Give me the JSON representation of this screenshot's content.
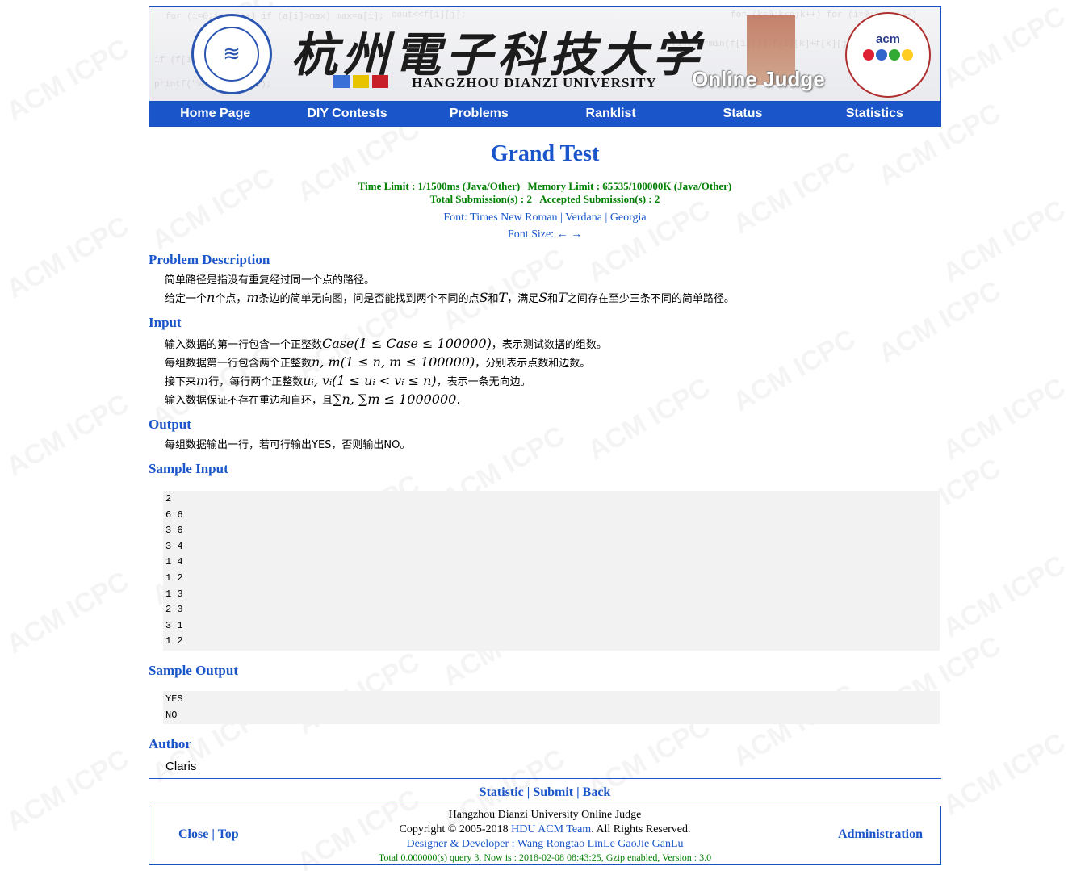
{
  "watermark": "ACM ICPC",
  "header": {
    "cn_title": "杭州電子科技大学",
    "en_title": "HANGZHOU DIANZI UNIVERSITY",
    "oj_title": "Online Judge",
    "acm_logo_text": "acm"
  },
  "nav": [
    {
      "label": "Home Page"
    },
    {
      "label": "DIY Contests"
    },
    {
      "label": "Problems"
    },
    {
      "label": "Ranklist"
    },
    {
      "label": "Status"
    },
    {
      "label": "Statistics"
    }
  ],
  "problem": {
    "title": "Grand Test",
    "time_limit": "Time Limit : 1/1500ms (Java/Other)",
    "memory_limit": "Memory Limit : 65535/100000K (Java/Other)",
    "total_submissions": "Total Submission(s) : 2",
    "accepted_submissions": "Accepted Submission(s) : 2",
    "font_label": "Font:",
    "fonts": [
      "Times New Roman",
      "Verdana",
      "Georgia"
    ],
    "font_size_label": "Font Size:",
    "font_size_arrows": "← →"
  },
  "sections": {
    "description_h": "Problem Description",
    "description": {
      "line1": "简单路径是指没有重复经过同一个点的路径。",
      "line2_a": "给定一个",
      "line2_n": "n",
      "line2_b": "个点，",
      "line2_m": "m",
      "line2_c": "条边的简单无向图，问是否能找到两个不同的点",
      "line2_S": "S",
      "line2_and1": "和",
      "line2_T": "T",
      "line2_d": "，满足",
      "line2_S2": "S",
      "line2_and2": "和",
      "line2_T2": "T",
      "line2_e": "之间存在至少三条不同的简单路径。"
    },
    "input_h": "Input",
    "input": {
      "l1_a": "输入数据的第一行包含一个正整数",
      "l1_math": "Case(1 ≤ Case ≤ 100000)",
      "l1_b": "，表示测试数据的组数。",
      "l2_a": "每组数据第一行包含两个正整数",
      "l2_math": "n, m(1 ≤ n, m ≤ 100000)",
      "l2_b": "，分别表示点数和边数。",
      "l3_a": "接下来",
      "l3_m": "m",
      "l3_b": "行，每行两个正整数",
      "l3_math": "uᵢ, vᵢ(1 ≤ uᵢ < vᵢ ≤ n)",
      "l3_c": "，表示一条无向边。",
      "l4_a": "输入数据保证不存在重边和自环，且",
      "l4_math": "∑n, ∑m ≤ 1000000.",
      "l4_b": ""
    },
    "output_h": "Output",
    "output": "每组数据输出一行，若可行输出YES，否则输出NO。",
    "sample_input_h": "Sample Input",
    "sample_input": [
      "2",
      "6 6",
      "3 6",
      "3 4",
      "1 4",
      "1 2",
      "1 3",
      "2 3",
      "3 1",
      "1 2"
    ],
    "sample_output_h": "Sample Output",
    "sample_output": [
      "YES",
      "NO"
    ],
    "author_h": "Author",
    "author": "Claris"
  },
  "bottom_links": [
    "Statistic",
    "Submit",
    "Back"
  ],
  "footer": {
    "close": "Close",
    "top": "Top",
    "line1": "Hangzhou Dianzi University Online Judge",
    "copyright_a": "Copyright © 2005-2018",
    "team": "HDU ACM Team",
    "copyright_b": ". All Rights Reserved.",
    "designer_label": "Designer & Developer :",
    "designers": "Wang Rongtao LinLe GaoJie GanLu",
    "stats": "Total 0.000000(s) query 3, Now is : 2018-02-08 08:43:25, Gzip enabled, Version : 3.0",
    "admin": "Administration"
  },
  "colors": {
    "accent": "#1a56c9",
    "green": "#008000",
    "sample_bg": "#f2f2f2"
  }
}
